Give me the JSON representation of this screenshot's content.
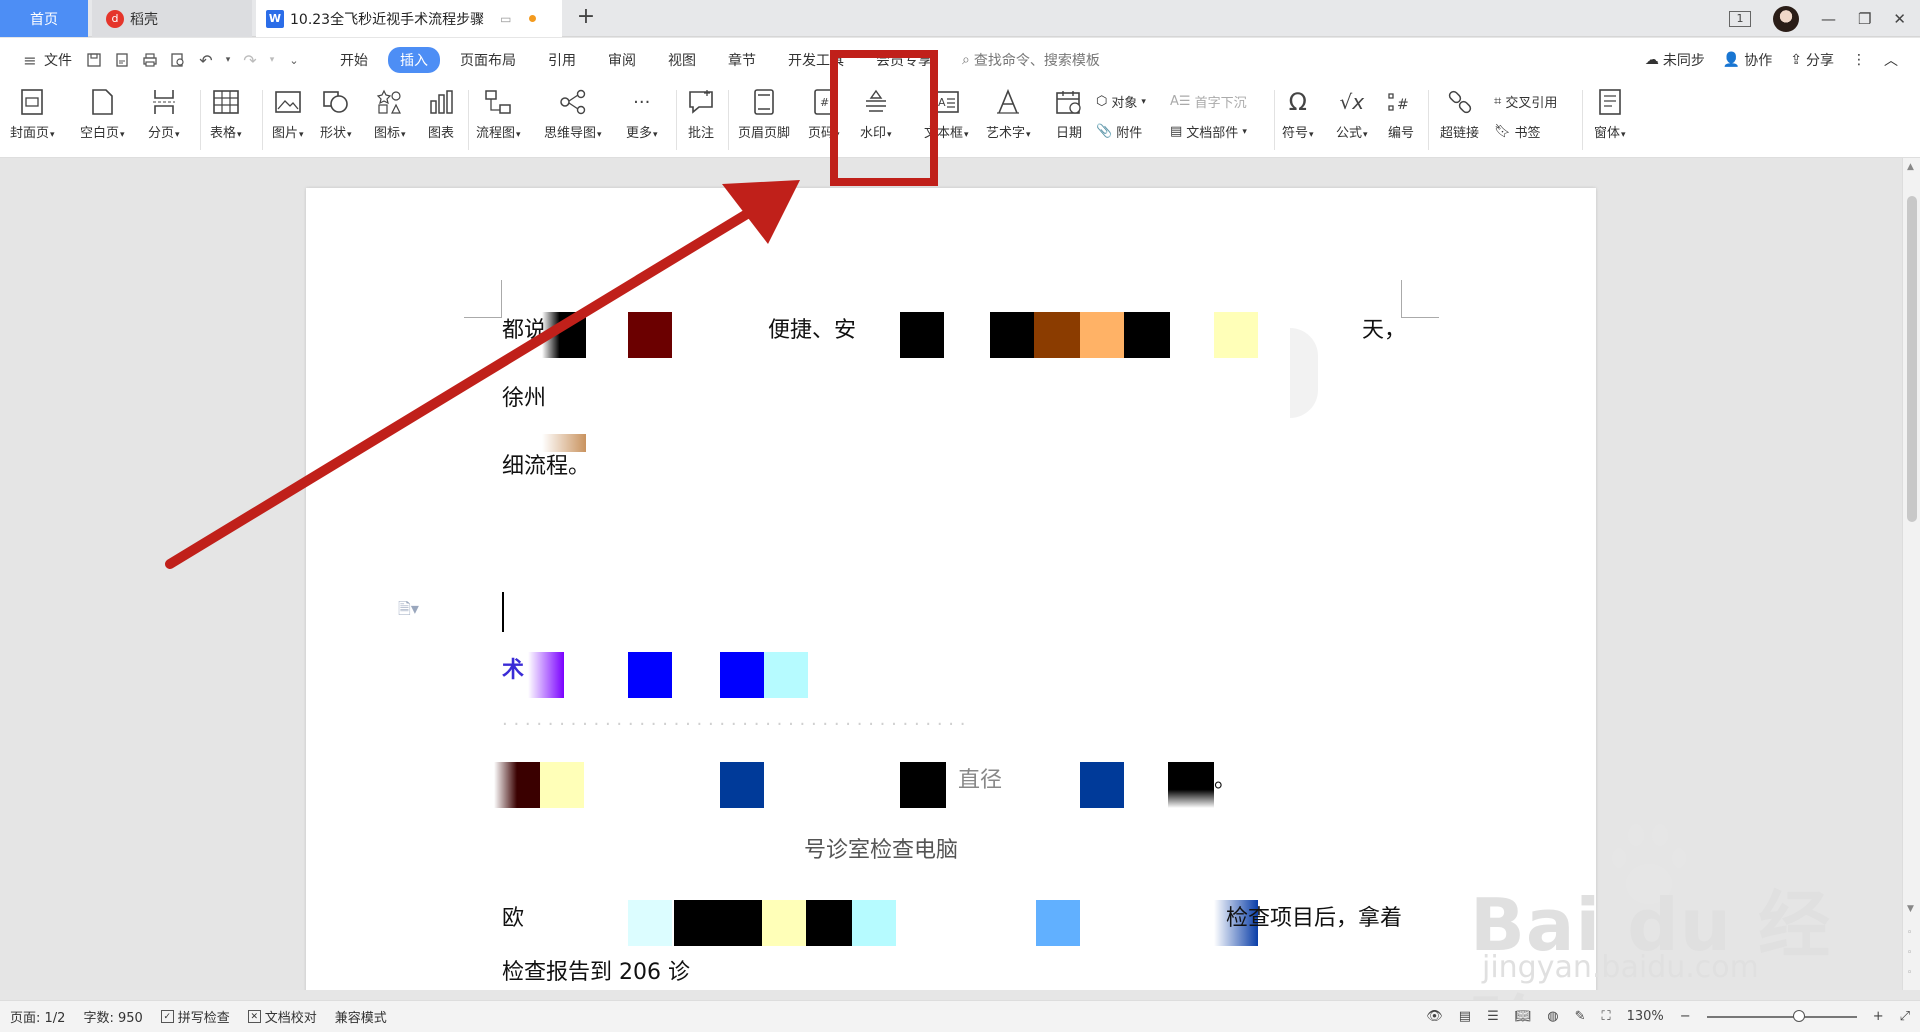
{
  "tabs": {
    "home": "首页",
    "daoke": "稻壳",
    "document": "10.23全飞秒近视手术流程步骤"
  },
  "menu": {
    "file": "文件",
    "tabs": [
      "开始",
      "插入",
      "页面布局",
      "引用",
      "审阅",
      "视图",
      "章节",
      "开发工具",
      "会员专享"
    ],
    "active_tab": "插入",
    "search_placeholder": "查找命令、搜索模板",
    "unsync": "未同步",
    "collab": "协作",
    "share": "分享"
  },
  "ribbon": {
    "cover": "封面页",
    "blank": "空白页",
    "pagebreak": "分页",
    "table": "表格",
    "picture": "图片",
    "shape": "形状",
    "icon": "图标",
    "chart": "图表",
    "flowchart": "流程图",
    "mindmap": "思维导图",
    "more": "更多",
    "comment": "批注",
    "header_footer": "页眉页脚",
    "page_number": "页码",
    "watermark": "水印",
    "textbox": "文本框",
    "wordart": "艺术字",
    "date": "日期",
    "object": "对象",
    "attachment": "附件",
    "dropcap": "首字下沉",
    "doc_parts": "文档部件",
    "symbol": "符号",
    "formula": "公式",
    "numbering": "编号",
    "hyperlink": "超链接",
    "crossref": "交叉引用",
    "bookmark": "书签",
    "form": "窗体"
  },
  "document": {
    "line1_a": "都说",
    "line1_b": "便捷、安",
    "line1_c": "天，",
    "line2": "徐州",
    "line3": "细流程。",
    "heading": "术",
    "line6": "直径",
    "line6_end": "。",
    "line7": "号诊室检查电脑",
    "line8_a": "欧",
    "line8_b": "检查项目后，拿着",
    "line9": "检查报告到 206 诊"
  },
  "watermark_logo": {
    "brand": "Bai du 经验",
    "url": "jingyan.baidu.com"
  },
  "statusbar": {
    "page": "页面: 1/2",
    "words": "字数: 950",
    "spellcheck": "拼写检查",
    "proofread": "文档校对",
    "compat": "兼容模式",
    "zoom": "130%"
  },
  "colors": {
    "accent": "#4d8ef5",
    "annotation": "#c0201a"
  }
}
